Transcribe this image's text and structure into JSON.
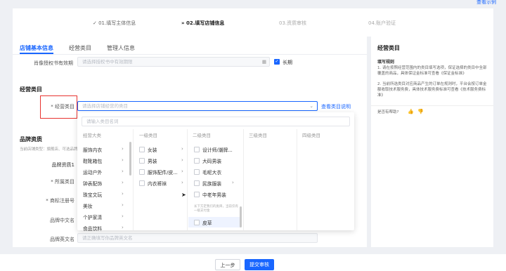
{
  "top_link": "查看示例",
  "steps": [
    {
      "label": "✓ 01.填写主体信息"
    },
    {
      "label": "» 02.填写店铺信息"
    },
    {
      "label": "03.资质审核"
    },
    {
      "label": "04.账户验证"
    }
  ],
  "tabs": [
    "店铺基本信息",
    "经营类目",
    "管理人信息"
  ],
  "auth_row": {
    "label": "肖像授权书有效期",
    "placeholder": "请选择授权书中有效期限",
    "checkbox_label": "长期"
  },
  "section_category": "经营类目",
  "category_field": {
    "label": "* 经营类目",
    "placeholder": "请选择店铺经营的类目",
    "link": "查看类目说明"
  },
  "search_placeholder": "请输入类目名词",
  "columns": [
    "经营大类",
    "一级类目",
    "二级类目",
    "三级类目",
    "四级类目"
  ],
  "col1": [
    "服饰内衣",
    "鞋靴箱包",
    "运动户外",
    "钟表配饰",
    "珠宝文玩",
    "美妆",
    "个护家清",
    "食品饮料"
  ],
  "col2": [
    "女装",
    "男装",
    "服饰配件/皮...",
    "内衣裤袜"
  ],
  "col3": [
    "设计师/潮牌...",
    "大码男装",
    "毛呢大衣",
    "民族服装",
    "中老年男装"
  ],
  "col3_hint": "长下方定我们的类目，当前仅有一级支付金",
  "col3_last": "皮草",
  "brand_section": {
    "title": "品牌资质",
    "desc": "当前店铺类型：旗舰店、可选品牌..."
  },
  "brand_labels": [
    "品牌资质1",
    "* 所属类目",
    "* 商标注册号",
    "品牌中文名",
    "品牌英文名"
  ],
  "brand_en_placeholder": "请正确填写你品牌英文名",
  "side_panel": {
    "title": "经营类目",
    "subtitle": "填写规则",
    "rule1": "1. 请在按照经营范围内的类目填写选项，保证选择的类目中全部覆盖的商品，具体保证金标准可查看《保证金标准》",
    "rule2": "2. 当前所选类目对应商品产生的订单在规则时，平台会按订单金额收取技术服务费，具体技术服务费标准可查看《技术服务费标准》",
    "help": "是否有帮助?"
  },
  "buttons": {
    "prev": "上一步",
    "submit": "提交审核"
  }
}
